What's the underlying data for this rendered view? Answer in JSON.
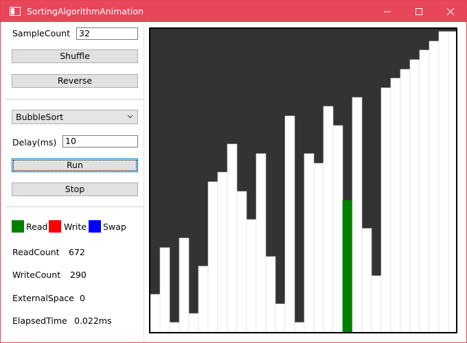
{
  "window": {
    "title": "SortingAlgorithmAnimation"
  },
  "controls": {
    "sample_count_label": "SampleCount",
    "sample_count_value": "32",
    "shuffle_label": "Shuffle",
    "reverse_label": "Reverse",
    "algorithm_selected": "BubbleSort",
    "delay_label": "Delay(ms)",
    "delay_value": "10",
    "run_label": "Run",
    "stop_label": "Stop"
  },
  "legend": {
    "read_label": "Read",
    "read_color": "#008000",
    "write_label": "Write",
    "write_color": "#ff0000",
    "swap_label": "Swap",
    "swap_color": "#0000ff"
  },
  "stats": {
    "read_count_label": "ReadCount",
    "read_count_value": "672",
    "write_count_label": "WriteCount",
    "write_count_value": "290",
    "external_space_label": "ExternalSpace",
    "external_space_value": "0",
    "elapsed_time_label": "ElapsedTime",
    "elapsed_time_value": "0.022ms"
  },
  "visualization": {
    "max_value": 32,
    "background_color": "#333333",
    "bar_color": "#ffffff",
    "values": [
      4,
      9,
      1,
      10,
      2,
      7,
      16,
      17,
      20,
      15,
      12,
      19,
      8,
      3,
      23,
      1,
      19,
      18,
      24,
      22,
      14,
      25,
      11,
      6,
      26,
      27,
      28,
      29,
      30,
      31,
      32,
      32
    ],
    "highlight_index": 20,
    "highlight_role": "read"
  }
}
